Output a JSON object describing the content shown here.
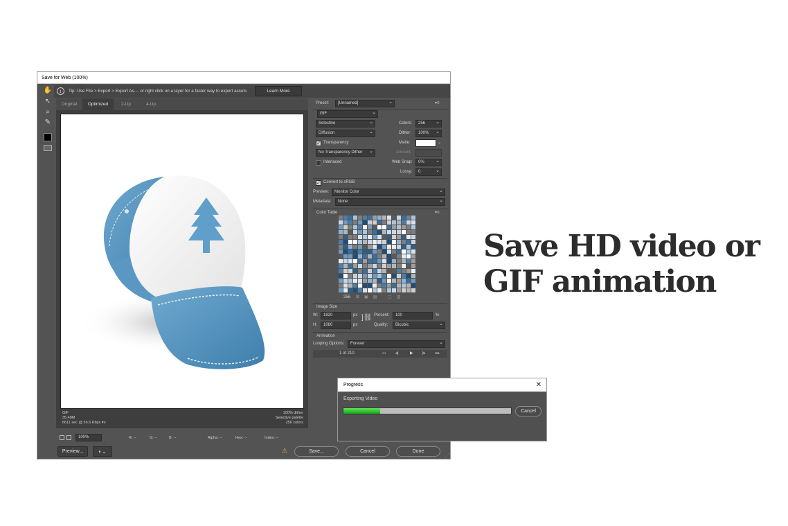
{
  "dialog": {
    "title": "Save for Web (100%)",
    "tip": "Tip: Use File > Export > Export As.... or right click on a layer for a faster way to export assets",
    "learn_more": "Learn More",
    "tools": [
      {
        "name": "hand-tool-icon",
        "glyph": "✋"
      },
      {
        "name": "slice-select-tool-icon",
        "glyph": "↖"
      },
      {
        "name": "zoom-tool-icon",
        "glyph": "🔍"
      },
      {
        "name": "eyedropper-tool-icon",
        "glyph": "✎"
      }
    ],
    "tabs": [
      "Original",
      "Optimized",
      "2-Up",
      "4-Up"
    ],
    "active_tab": "Optimized"
  },
  "image_info": {
    "left": [
      "GIF",
      "35.48M",
      "6611 sec @ 56.6 Kbps"
    ],
    "right": [
      "100% dither",
      "Selective palette",
      "256 colors"
    ],
    "menu_glyph": "▾≡"
  },
  "status_bar": {
    "zoom": "100%",
    "r": "R: --",
    "g": "G: --",
    "b": "B: --",
    "alpha": "Alpha: --",
    "hex": "Hex: --",
    "index": "Index: --"
  },
  "footer": {
    "preview": "Preview...",
    "save": "Save...",
    "cancel": "Cancel",
    "done": "Done"
  },
  "settings": {
    "preset_label": "Preset:",
    "preset_value": "[Unnamed]",
    "format": "GIF",
    "reduction": "Selective",
    "dither_algo": "Diffusion",
    "colors_label": "Colors:",
    "colors_value": "256",
    "dither_label": "Dither:",
    "dither_value": "100%",
    "transparency_label": "Transparency",
    "transparency_checked": true,
    "matte_label": "Matte:",
    "transparency_dither": "No Transparency Dither",
    "amount_label": "Amount:",
    "interlaced_label": "Interlaced",
    "interlaced_checked": false,
    "websnap_label": "Web Snap:",
    "websnap_value": "0%",
    "lossy_label": "Lossy:",
    "lossy_value": "0",
    "convert_srgb_label": "Convert to sRGB",
    "convert_srgb_checked": true,
    "preview_label": "Preview:",
    "preview_value": "Monitor Color",
    "metadata_label": "Metadata:",
    "metadata_value": "None"
  },
  "color_table": {
    "title": "Color Table",
    "count": "256",
    "palette": [
      "#1f4e79",
      "#3b6fa0",
      "#6f9bc4",
      "#a9c6df",
      "#d9e4ee",
      "#ffffff",
      "#b5b5b5",
      "#7e7e7e",
      "#4d7ea8",
      "#8fb3d3",
      "#c7d8e8",
      "#e9eef3",
      "#5a5a5a",
      "#2d5f8a",
      "#9d9d9d",
      "#d0d0d0"
    ]
  },
  "image_size": {
    "title": "Image Size",
    "w_label": "W:",
    "w_value": "1920",
    "h_label": "H:",
    "h_value": "1080",
    "unit": "px",
    "percent_label": "Percent:",
    "percent_value": "100",
    "percent_unit": "%",
    "quality_label": "Quality:",
    "quality_value": "Bicubic"
  },
  "animation": {
    "title": "Animation",
    "looping_label": "Looping Options:",
    "looping_value": "Forever",
    "frame_counter": "1 of 210"
  },
  "progress": {
    "title": "Progress",
    "message": "Exporting Video",
    "fraction": 0.22,
    "cancel": "Cancel"
  },
  "headline": {
    "line1": "Save HD video or",
    "line2": "GIF animation"
  }
}
